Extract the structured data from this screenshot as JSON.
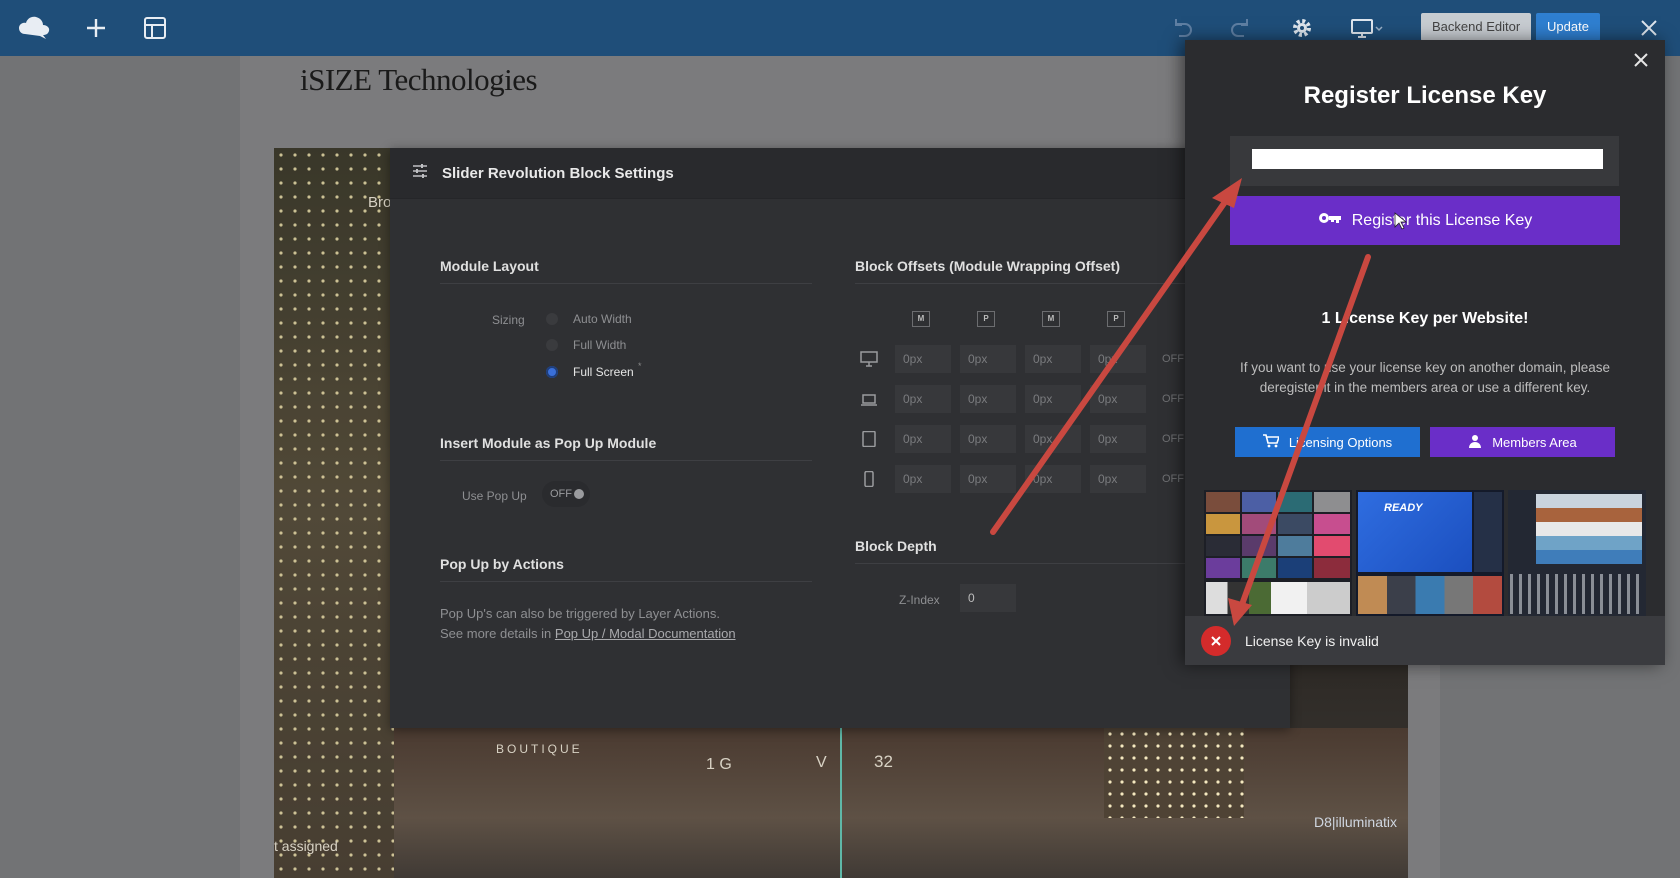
{
  "toolbar": {
    "backend_editor_label": "Backend Editor",
    "update_label": "Update"
  },
  "page": {
    "site_title": "iSIZE Technologies",
    "media_texts": {
      "bro": "Bro",
      "assigned": "t assigned",
      "boutique": "BOUTIQUE",
      "sign_one": "1 G",
      "sign_v": "V",
      "sign_32": "32",
      "watermark": "D8|illuminatix"
    }
  },
  "panel": {
    "title": "Slider Revolution Block Settings",
    "module_layout": {
      "title": "Module Layout",
      "sizing_label": "Sizing",
      "options": [
        "Auto Width",
        "Full Width",
        "Full Screen"
      ],
      "selected": "Full Screen"
    },
    "popup": {
      "title": "Insert Module as Pop Up Module",
      "use_popup_label": "Use Pop Up",
      "use_popup_value": "OFF"
    },
    "popup_actions": {
      "title": "Pop Up by Actions",
      "desc_line1": "Pop Up's can also be triggered by Layer Actions.",
      "desc_line2_prefix": "See more details in ",
      "desc_link": "Pop Up / Modal Documentation"
    },
    "offsets": {
      "title": "Block Offsets (Module Wrapping Offset)",
      "column_icons": [
        "M",
        "P",
        "M",
        "P"
      ],
      "rows": [
        {
          "device": "desktop-icon",
          "values": [
            "0px",
            "0px",
            "0px",
            "0px"
          ],
          "toggle": "OFF"
        },
        {
          "device": "laptop-icon",
          "values": [
            "0px",
            "0px",
            "0px",
            "0px"
          ],
          "toggle": "OFF"
        },
        {
          "device": "tablet-icon",
          "values": [
            "0px",
            "0px",
            "0px",
            "0px"
          ],
          "toggle": "OFF"
        },
        {
          "device": "mobile-icon",
          "values": [
            "0px",
            "0px",
            "0px",
            "0px"
          ],
          "toggle": "OFF"
        }
      ]
    },
    "depth": {
      "title": "Block Depth",
      "zindex_label": "Z-Index",
      "zindex_value": "0"
    }
  },
  "license_modal": {
    "title": "Register License Key",
    "key_value": "",
    "register_label": "Register this License Key",
    "per_site_title": "1 License Key per Website!",
    "info_text": "If you want to use your license key on another domain, please deregister it in the members area or use a different key.",
    "licensing_options_label": "Licensing Options",
    "members_area_label": "Members Area",
    "thumb_ready_text": "READY",
    "toast_message": "License Key is invalid"
  },
  "colors": {
    "toolbar_bg": "#1f4e79",
    "update_btn": "#2f7fd0",
    "register_btn": "#6a2ec8",
    "licensing_btn": "#1f6fd0",
    "members_btn": "#6a2ec8",
    "error_red": "#d42b2b",
    "arrow_red": "#c94840"
  }
}
